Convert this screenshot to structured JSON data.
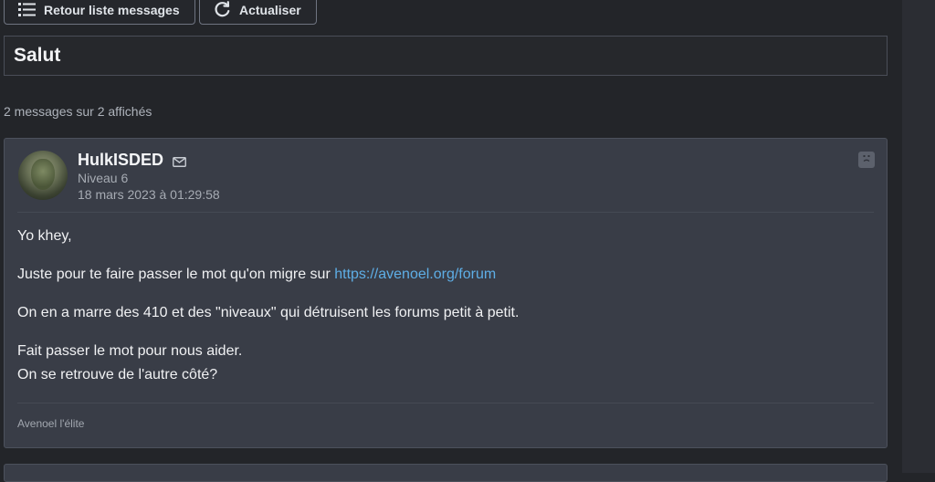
{
  "toolbar": {
    "back_label": "Retour liste messages",
    "refresh_label": "Actualiser"
  },
  "topic": {
    "title": "Salut"
  },
  "messages_count": "2 messages sur 2 affichés",
  "post": {
    "author": "HulkISDED",
    "level": "Niveau 6",
    "date": "18 mars 2023 à 01:29:58",
    "body": {
      "line1": "Yo khey,",
      "line2_prefix": "Juste pour te faire passer le mot qu'on migre sur ",
      "link": "https://avenoel.org/forum",
      "line3": "On en a marre des 410 et des \"niveaux\" qui détruisent les forums petit à petit.",
      "line4": "Fait passer le mot pour nous aider.",
      "line5": "On se retrouve de l'autre côté?"
    },
    "signature": "Avenoel l'élite"
  },
  "colors": {
    "background": "#232529",
    "card": "#393d47",
    "link": "#5eaee6"
  },
  "icons": {
    "back": "list-icon",
    "refresh": "refresh-icon",
    "mail": "envelope-icon",
    "flag": "sad-face-icon"
  }
}
